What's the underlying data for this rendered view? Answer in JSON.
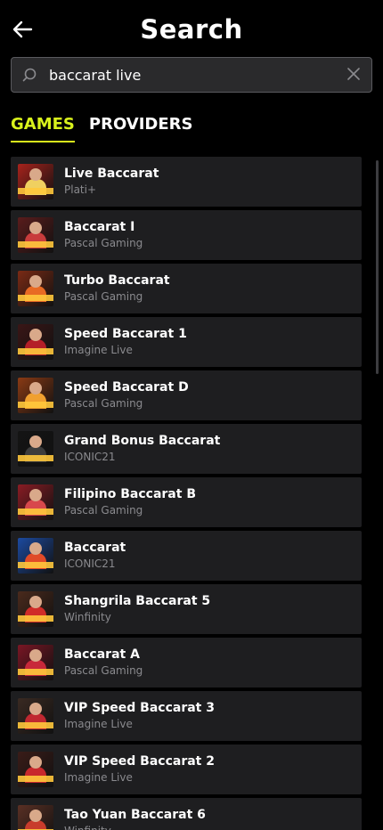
{
  "header": {
    "title": "Search"
  },
  "search": {
    "value": "baccarat live",
    "placeholder": ""
  },
  "tabs": [
    {
      "label": "GAMES",
      "active": true
    },
    {
      "label": "PROVIDERS",
      "active": false
    }
  ],
  "results": [
    {
      "name": "Live Baccarat",
      "provider": "Plati+",
      "bg": "#a8231c",
      "accent": "#f0d060"
    },
    {
      "name": "Baccarat I",
      "provider": "Pascal Gaming",
      "bg": "#5a1c1c",
      "accent": "#c83c3c"
    },
    {
      "name": "Turbo Baccarat",
      "provider": "Pascal Gaming",
      "bg": "#7a2a14",
      "accent": "#e86a24"
    },
    {
      "name": "Speed Baccarat 1",
      "provider": "Imagine Live",
      "bg": "#3a1616",
      "accent": "#b41e28"
    },
    {
      "name": "Speed Baccarat D",
      "provider": "Pascal Gaming",
      "bg": "#8a3a14",
      "accent": "#f0a030"
    },
    {
      "name": "Grand Bonus Baccarat",
      "provider": "ICONIC21",
      "bg": "#141414",
      "accent": "#3c3c3c"
    },
    {
      "name": "Filipino Baccarat B",
      "provider": "Pascal Gaming",
      "bg": "#8a1c24",
      "accent": "#d8484c"
    },
    {
      "name": "Baccarat",
      "provider": "ICONIC21",
      "bg": "#1c4aa0",
      "accent": "#e04a28"
    },
    {
      "name": "Shangrila Baccarat 5",
      "provider": "Winfinity",
      "bg": "#4a2a1c",
      "accent": "#d02c28"
    },
    {
      "name": "Baccarat A",
      "provider": "Pascal Gaming",
      "bg": "#7a1624",
      "accent": "#c8283a"
    },
    {
      "name": "VIP Speed Baccarat 3",
      "provider": "Imagine Live",
      "bg": "#3a2a22",
      "accent": "#c02830"
    },
    {
      "name": "VIP Speed Baccarat 2",
      "provider": "Imagine Live",
      "bg": "#3a1c18",
      "accent": "#c8282c"
    },
    {
      "name": "Tao Yuan Baccarat 6",
      "provider": "Winfinity",
      "bg": "#5a3024",
      "accent": "#c83c2c"
    }
  ],
  "icons": {
    "back": "arrow-left-icon",
    "search": "search-icon",
    "clear": "close-icon"
  },
  "colors": {
    "accent": "#d9f21c",
    "background": "#000000",
    "row": "#1e1e20"
  }
}
